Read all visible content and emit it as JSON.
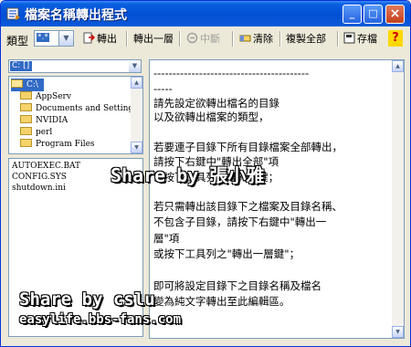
{
  "window": {
    "title": "檔案名稱轉出程式",
    "buttons": {
      "minimize": "_",
      "maximize": "□",
      "close": "×"
    }
  },
  "toolbar": {
    "type_label": "類型",
    "type_value": "*.*",
    "export": "轉出",
    "export_layer": "轉出一層",
    "interrupt": "中斷",
    "clear": "清除",
    "copy_all": "複製全部",
    "save": "存檔",
    "help": "?"
  },
  "drive": {
    "value": "C: []"
  },
  "folders": [
    {
      "name": "C:\\",
      "selected": true,
      "open": true
    },
    {
      "name": "AppServ"
    },
    {
      "name": "Documents and Settings"
    },
    {
      "name": "NVIDIA"
    },
    {
      "name": "perl"
    },
    {
      "name": "Program Files"
    }
  ],
  "files": [
    "AUTOEXEC.BAT",
    "CONFIG.SYS",
    "shutdown.ini"
  ],
  "text_lines": [
    "-----------------------------------------",
    "-----",
    "請先設定欲轉出檔名的目錄",
    "以及欲轉出檔案的類型，",
    "",
    "若要連子目錄下所有目錄檔案全部轉出，",
    "請按下右鍵中\"轉出全部\"項",
    "或按下工具列之\"轉出\"鍵；",
    "",
    "若只需轉出該目錄下之檔案及目錄名稱、",
    "不包含子目錄，請按下右鍵中\"轉出一",
    "層\"項",
    "或按下工具列之\"轉出一層鍵\"；",
    "",
    "即可將設定目錄下之目錄名稱及檔名",
    "變為純文字轉出至此編輯區。"
  ],
  "watermarks": {
    "share1": "Share by 張小雅",
    "share2": "Share by cslu",
    "url": "easylife.bbs-fans.com"
  },
  "colors": {
    "titlebar": "#0350d4",
    "selection": "#316ac5",
    "face": "#ece9d8"
  }
}
